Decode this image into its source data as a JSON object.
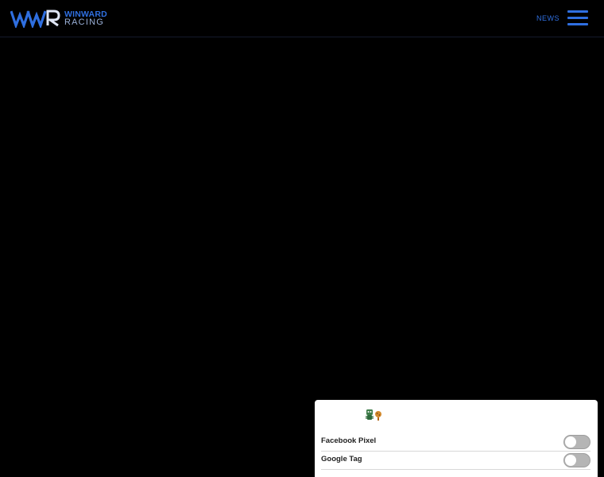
{
  "header": {
    "brand": {
      "mark": "WWR",
      "line1": "WINWARD",
      "line2": "RACING"
    },
    "nav": {
      "news": "NEWS"
    },
    "menu_icon": "hamburger-menu-icon"
  },
  "consent": {
    "icon": "cookie-mascot-icon",
    "items": [
      {
        "label": "Facebook Pixel",
        "enabled": false
      },
      {
        "label": "Google Tag",
        "enabled": false
      }
    ]
  },
  "colors": {
    "background": "#000000",
    "accent": "#2f6fe0",
    "panel": "#ffffff",
    "toggle_off": "#b5b5b5"
  }
}
